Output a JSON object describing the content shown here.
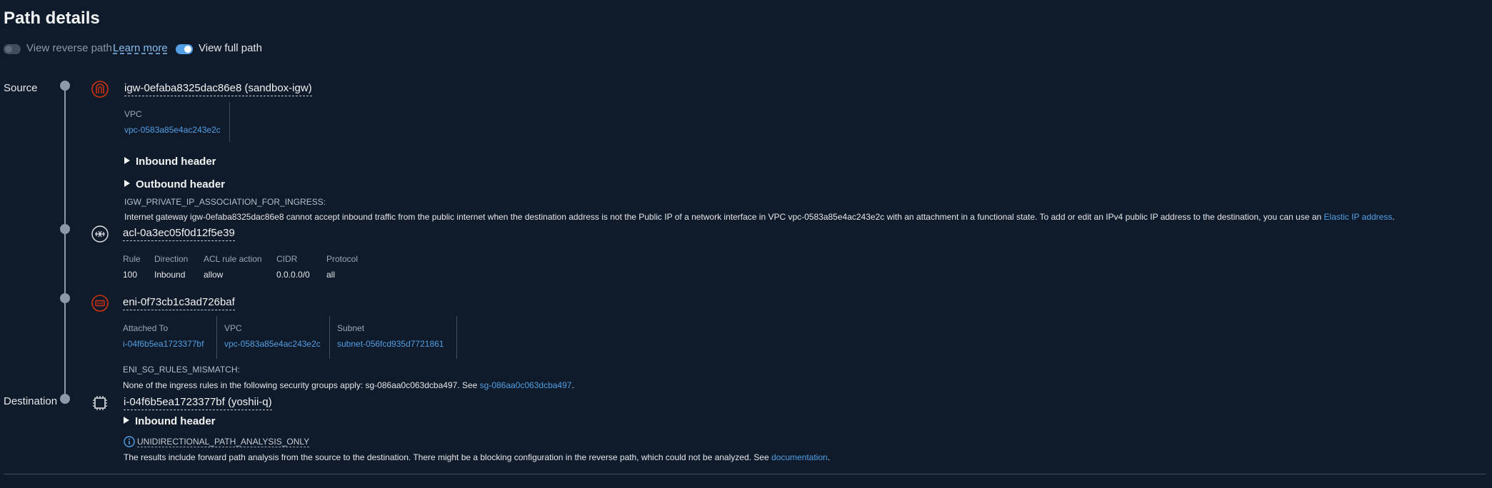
{
  "header": {
    "title": "Path details"
  },
  "toggles": {
    "reverse_label": "View reverse path",
    "learn_more": "Learn more",
    "full_label": "View full path"
  },
  "labels": {
    "source": "Source",
    "destination": "Destination"
  },
  "igw": {
    "title": "igw-0efaba8325dac86e8 (sandbox-igw)",
    "vpc_key": "VPC",
    "vpc_value": "vpc-0583a85e4ac243e2c",
    "inbound_header": "Inbound header",
    "outbound_header": "Outbound header",
    "error_code": "IGW_PRIVATE_IP_ASSOCIATION_FOR_INGRESS:",
    "error_text": "Internet gateway igw-0efaba8325dac86e8 cannot accept inbound traffic from the public internet when the destination address is not the Public IP of a network interface in VPC vpc-0583a85e4ac243e2c with an attachment in a functional state. To add or edit an IPv4 public IP address to the destination, you can use an ",
    "error_link": "Elastic IP address",
    "error_tail": "."
  },
  "acl": {
    "title": "acl-0a3ec05f0d12f5e39",
    "columns": [
      "Rule",
      "Direction",
      "ACL rule action",
      "CIDR",
      "Protocol"
    ],
    "row": [
      "100",
      "Inbound",
      "allow",
      "0.0.0.0/0",
      "all"
    ]
  },
  "eni": {
    "title": "eni-0f73cb1c3ad726baf",
    "attached_key": "Attached To",
    "attached_value": "i-04f6b5ea1723377bf",
    "vpc_key": "VPC",
    "vpc_value": "vpc-0583a85e4ac243e2c",
    "subnet_key": "Subnet",
    "subnet_value": "subnet-056fcd935d7721861",
    "error_code": "ENI_SG_RULES_MISMATCH:",
    "error_text": "None of the ingress rules in the following security groups apply: sg-086aa0c063dcba497. See ",
    "error_link": "sg-086aa0c063dcba497",
    "error_tail": "."
  },
  "instance": {
    "title": "i-04f6b5ea1723377bf (yoshii-q)",
    "inbound_header": "Inbound header",
    "info_code": "UNIDIRECTIONAL_PATH_ANALYSIS_ONLY",
    "info_text": "The results include forward path analysis from the source to the destination. There might be a blocking configuration in the reverse path, which could not be analyzed. See ",
    "info_link": "documentation",
    "info_tail": "."
  },
  "icons": {
    "igw": "internet-gateway-icon",
    "acl": "network-acl-icon",
    "eni": "network-interface-icon",
    "instance": "instance-chip-icon",
    "info": "info-icon"
  },
  "colors": {
    "accent": "#539fe5",
    "error": "#d13212",
    "background": "#0f1b2a"
  }
}
